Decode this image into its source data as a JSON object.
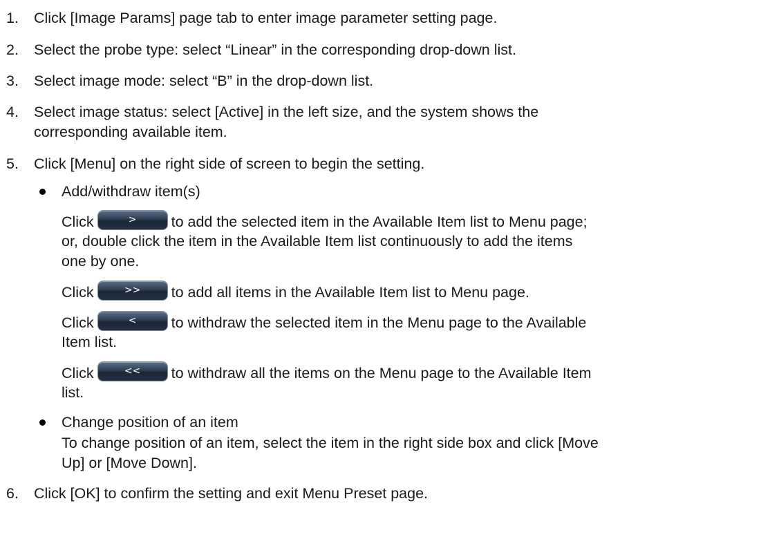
{
  "steps": [
    {
      "num": "1.",
      "text": "Click [Image Params] page tab to enter image parameter setting page."
    },
    {
      "num": "2.",
      "text": "Select the probe type: select “Linear” in the corresponding drop-down list."
    },
    {
      "num": "3.",
      "text": "Select image mode: select “B” in the drop-down list."
    },
    {
      "num": "4.",
      "text": "Select image status: select [Active] in the left size, and the system shows the",
      "text2": "corresponding available item."
    },
    {
      "num": "5.",
      "text": "Click [Menu] on the right side of screen to begin the setting."
    },
    {
      "num": "6.",
      "text": "Click [OK] to confirm the setting and exit Menu Preset page."
    }
  ],
  "bullets": [
    {
      "title": "Add/withdraw item(s)"
    },
    {
      "title": "Change position of an item",
      "body1": "To change position of an item, select the item in the right side box and click [Move",
      "body2": "Up] or [Move Down]."
    }
  ],
  "actions": [
    {
      "click": "Click",
      "button": ">",
      "text": "to add the selected item in the Available Item list to Menu page;",
      "text2": "or, double click the item in the Available Item list continuously to add the items",
      "text3": "one by one."
    },
    {
      "click": "Click",
      "button": ">>",
      "text": "to add all items in the Available Item list to Menu page."
    },
    {
      "click": "Click",
      "button": "<",
      "text": "to withdraw the selected item in the Menu page to the Available",
      "text2": "Item list."
    },
    {
      "click": "Click",
      "button": "<<",
      "text": "to withdraw all the items on the Menu page to the Available Item",
      "text2": "list."
    }
  ]
}
